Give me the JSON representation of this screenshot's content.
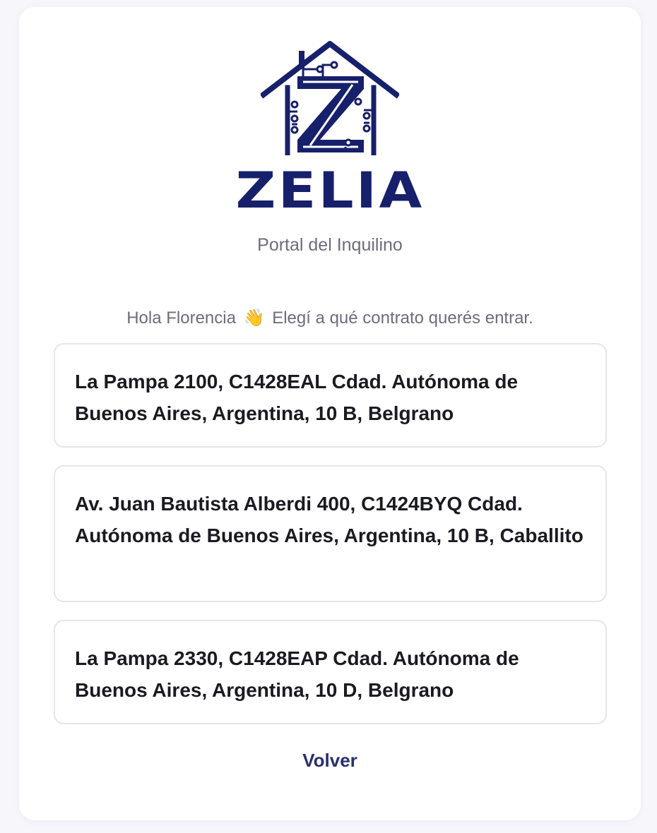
{
  "brand": {
    "name": "ZELIA",
    "subtitle": "Portal del Inquilino",
    "color": "#17206b"
  },
  "greeting": {
    "before": "Hola Florencia",
    "emoji": "👋",
    "after": "Elegí a qué contrato querés entrar."
  },
  "contracts": [
    {
      "address": "La Pampa 2100, C1428EAL Cdad. Autónoma de Buenos Aires, Argentina, 10 B, Belgrano"
    },
    {
      "address": "Av. Juan Bautista Alberdi 400, C1424BYQ Cdad. Autónoma de Buenos Aires, Argentina, 10 B, Caballito"
    },
    {
      "address": "La Pampa 2330, C1428EAP Cdad. Autónoma de Buenos Aires, Argentina, 10 D, Belgrano"
    }
  ],
  "actions": {
    "back_label": "Volver"
  },
  "icons": {
    "logo": "house-circuit-z-logo-icon",
    "wave": "waving-hand-icon"
  }
}
